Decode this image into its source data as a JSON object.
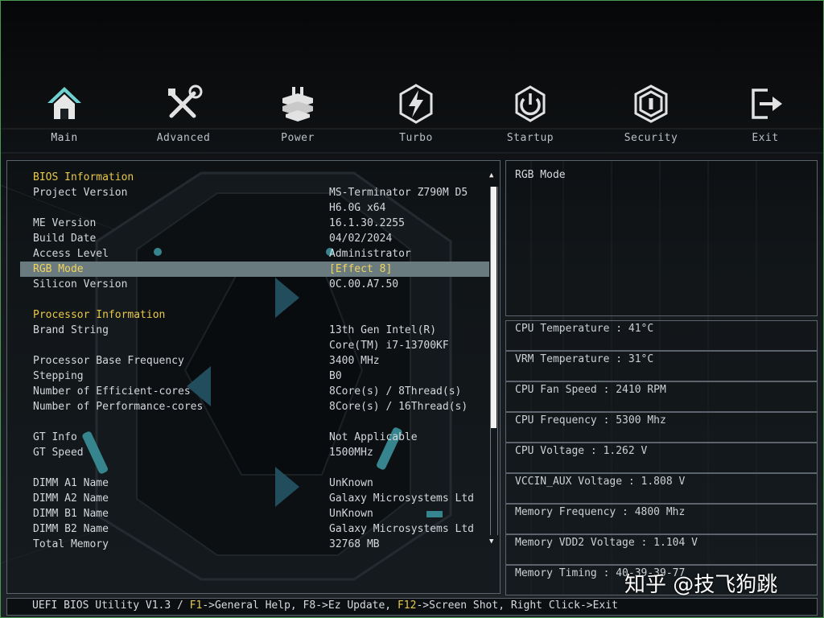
{
  "menu": [
    {
      "id": "main",
      "label": "Main",
      "icon": "home-icon",
      "active": true
    },
    {
      "id": "advanced",
      "label": "Advanced",
      "icon": "tools-icon",
      "active": false
    },
    {
      "id": "power",
      "label": "Power",
      "icon": "power-chip-icon",
      "active": false
    },
    {
      "id": "turbo",
      "label": "Turbo",
      "icon": "turbo-bolt-icon",
      "active": false
    },
    {
      "id": "startup",
      "label": "Startup",
      "icon": "power-button-icon",
      "active": false
    },
    {
      "id": "security",
      "label": "Security",
      "icon": "security-shield-icon",
      "active": false
    },
    {
      "id": "exit",
      "label": "Exit",
      "icon": "exit-icon",
      "active": false
    }
  ],
  "colors": {
    "accent_active": "#6fd0d0",
    "section": "#e8c84a",
    "selected_bg": "#6a7b80",
    "frame": "#4a9a54"
  },
  "main": {
    "rows": [
      {
        "type": "section",
        "label": "BIOS Information",
        "value": ""
      },
      {
        "type": "item",
        "label": "Project Version",
        "value": "MS-Terminator Z790M D5"
      },
      {
        "type": "item",
        "label": "",
        "value": "H6.0G x64"
      },
      {
        "type": "item",
        "label": "ME Version",
        "value": "16.1.30.2255"
      },
      {
        "type": "item",
        "label": "Build Date",
        "value": "04/02/2024"
      },
      {
        "type": "item",
        "label": "Access Level",
        "value": "Administrator"
      },
      {
        "type": "selected",
        "label": "RGB Mode",
        "value": "[Effect 8]"
      },
      {
        "type": "item",
        "label": "Silicon Version",
        "value": "0C.00.A7.50"
      },
      {
        "type": "blank",
        "label": "",
        "value": ""
      },
      {
        "type": "section",
        "label": "Processor Information",
        "value": ""
      },
      {
        "type": "item",
        "label": "Brand String",
        "value": "13th Gen Intel(R)"
      },
      {
        "type": "item",
        "label": "",
        "value": "Core(TM) i7-13700KF"
      },
      {
        "type": "item",
        "label": "Processor Base Frequency",
        "value": "3400 MHz"
      },
      {
        "type": "item",
        "label": "Stepping",
        "value": "B0"
      },
      {
        "type": "item",
        "label": "Number of Efficient-cores",
        "value": "8Core(s) / 8Thread(s)"
      },
      {
        "type": "item",
        "label": "Number of Performance-cores",
        "value": "8Core(s) / 16Thread(s)"
      },
      {
        "type": "blank",
        "label": "",
        "value": ""
      },
      {
        "type": "item",
        "label": "GT Info",
        "value": "Not Applicable"
      },
      {
        "type": "item",
        "label": "GT Speed",
        "value": "1500MHz"
      },
      {
        "type": "blank",
        "label": "",
        "value": ""
      },
      {
        "type": "item",
        "label": "DIMM A1 Name",
        "value": "UnKnown"
      },
      {
        "type": "item",
        "label": "DIMM A2 Name",
        "value": "Galaxy Microsystems Ltd"
      },
      {
        "type": "item",
        "label": "DIMM B1 Name",
        "value": "UnKnown"
      },
      {
        "type": "item",
        "label": "DIMM B2 Name",
        "value": "Galaxy Microsystems Ltd"
      },
      {
        "type": "item",
        "label": "Total Memory",
        "value": "32768 MB"
      }
    ],
    "scroll_up": "▲",
    "scroll_down": "▼"
  },
  "help": {
    "title": "RGB Mode"
  },
  "monitor": [
    "CPU Temperature : 41°C",
    "VRM Temperature : 31°C",
    "CPU Fan Speed : 2410 RPM",
    "CPU Frequency : 5300 Mhz",
    "CPU Voltage : 1.262 V",
    "VCCIN_AUX Voltage : 1.808 V",
    "Memory Frequency : 4800 Mhz",
    "Memory VDD2 Voltage : 1.104 V",
    "Memory Timing : 40-39-39-77"
  ],
  "status_bar": {
    "prefix": "UEFI BIOS Utility V1.3 / ",
    "f1": "F1",
    "f1_text": "->General Help, F8->Ez Update, ",
    "f12": "F12",
    "f12_text": "->Screen Shot, Right Click->Exit"
  },
  "watermark": "知乎 @技飞狗跳"
}
